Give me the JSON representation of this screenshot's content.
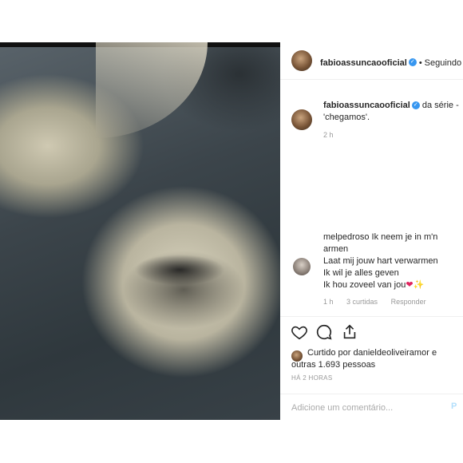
{
  "post": {
    "image_alt_icon": "photo-lips-closeup"
  },
  "header": {
    "username": "fabioassuncaooficial",
    "separator": "•",
    "follow_label": "Seguindo"
  },
  "caption": {
    "username": "fabioassuncaooficial",
    "text": "da série -",
    "text2": "'chegamos'.",
    "time": "2 h"
  },
  "comment": {
    "username": "melpedroso",
    "lines": [
      "Ik neem je in m'n",
      "armen",
      "Laat mij jouw hart verwarmen",
      "Ik wil je alles geven",
      "Ik hou zoveel van jou"
    ],
    "emoji": "❤✨",
    "time": "1 h",
    "likes": "3 curtidas",
    "reply": "Responder"
  },
  "actions": {
    "liked_by_prefix": "Curtido por",
    "liked_by_user": "danieldeoliveiramor",
    "liked_by_rest": "e",
    "others": "outras 1.693 pessoas",
    "timestamp": "HÁ 2 HORAS"
  },
  "composer": {
    "placeholder": "Adicione um comentário...",
    "publish_label": "P"
  }
}
